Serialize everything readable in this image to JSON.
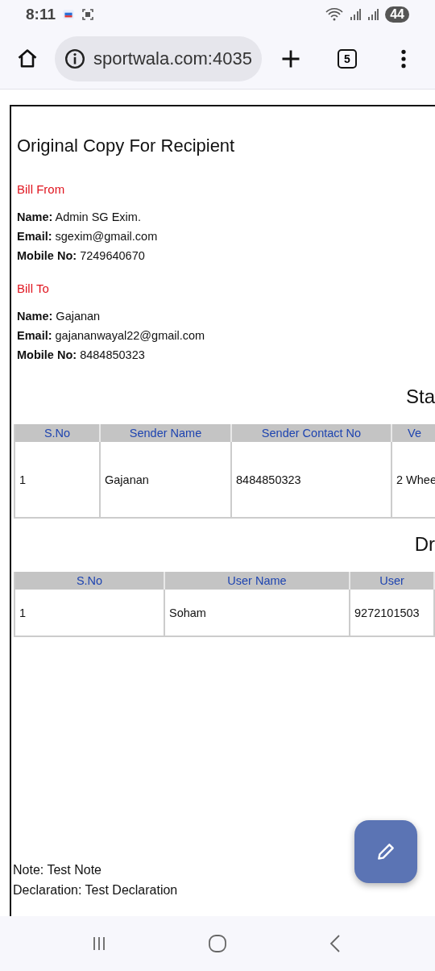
{
  "status_bar": {
    "time": "8:11",
    "battery": "44"
  },
  "browser": {
    "url": "sportwala.com:4035",
    "tab_count": "5"
  },
  "page": {
    "title": "Original Copy For Recipient",
    "parties": [
      {
        "heading": "Bill From",
        "fields": [
          {
            "label": "Name:",
            "value": "Admin SG Exim."
          },
          {
            "label": "Email:",
            "value": "sgexim@gmail.com"
          },
          {
            "label": "Mobile No:",
            "value": "7249640670"
          }
        ]
      },
      {
        "heading": "Bill To",
        "fields": [
          {
            "label": "Name:",
            "value": "Gajanan"
          },
          {
            "label": "Email:",
            "value": "gajananwayal22@gmail.com"
          },
          {
            "label": "Mobile No:",
            "value": " 8484850323"
          }
        ]
      }
    ],
    "tables": [
      {
        "heading": "Sta",
        "kind": "tall",
        "columns": [
          "S.No",
          "Sender Name",
          "Sender Contact No",
          "Ve"
        ],
        "rows": [
          [
            "1",
            "Gajanan",
            "8484850323",
            "2 Whee"
          ]
        ]
      },
      {
        "heading": "Dr",
        "kind": "short",
        "columns": [
          "S.No",
          "User Name",
          "User"
        ],
        "rows": [
          [
            "1",
            "Soham",
            "9272101503"
          ]
        ]
      }
    ],
    "notes": [
      "Note: Test Note",
      "Declaration: Test Declaration"
    ]
  }
}
